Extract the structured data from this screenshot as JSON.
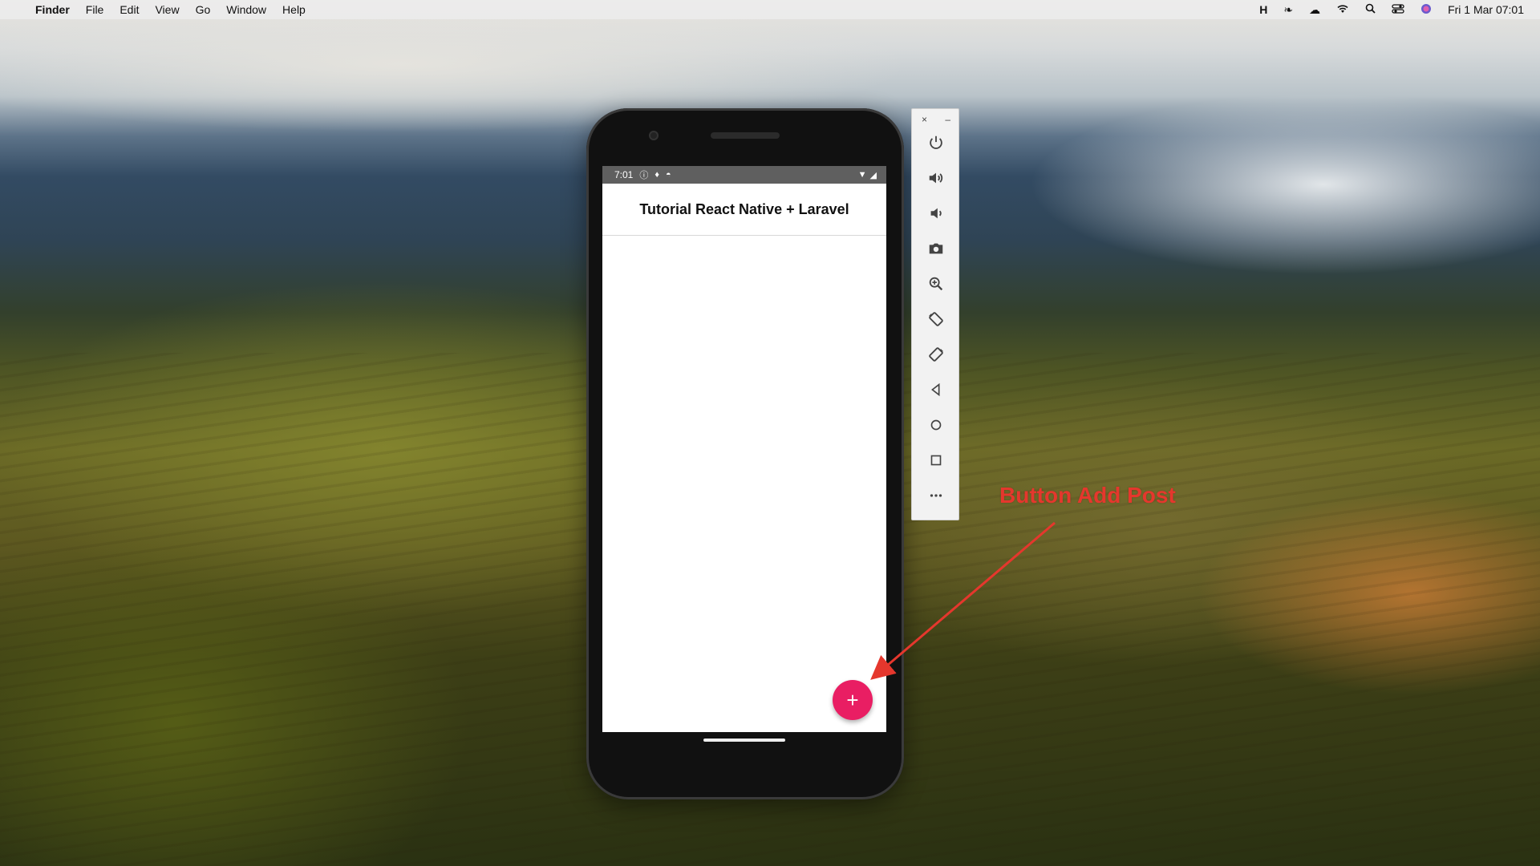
{
  "menubar": {
    "app_name": "Finder",
    "menus": [
      "File",
      "Edit",
      "View",
      "Go",
      "Window",
      "Help"
    ],
    "status_icons": [
      "h-icon",
      "leaf-icon",
      "cloud-icon",
      "wifi-icon",
      "search-icon",
      "control-center-icon",
      "siri-icon"
    ],
    "clock": "Fri 1 Mar  07:01"
  },
  "phone": {
    "status_time": "7:01",
    "app_title": "Tutorial React Native + Laravel",
    "fab_label": "+",
    "accent_color": "#e91e63"
  },
  "emulator_toolbar": {
    "close_label": "×",
    "minimize_label": "–",
    "buttons": [
      "power-icon",
      "volume-up-icon",
      "volume-down-icon",
      "camera-icon",
      "zoom-icon",
      "rotate-left-icon",
      "rotate-right-icon",
      "back-icon",
      "home-icon",
      "overview-icon",
      "more-icon"
    ]
  },
  "annotation": {
    "text": "Button Add Post",
    "color": "#e5372d"
  }
}
